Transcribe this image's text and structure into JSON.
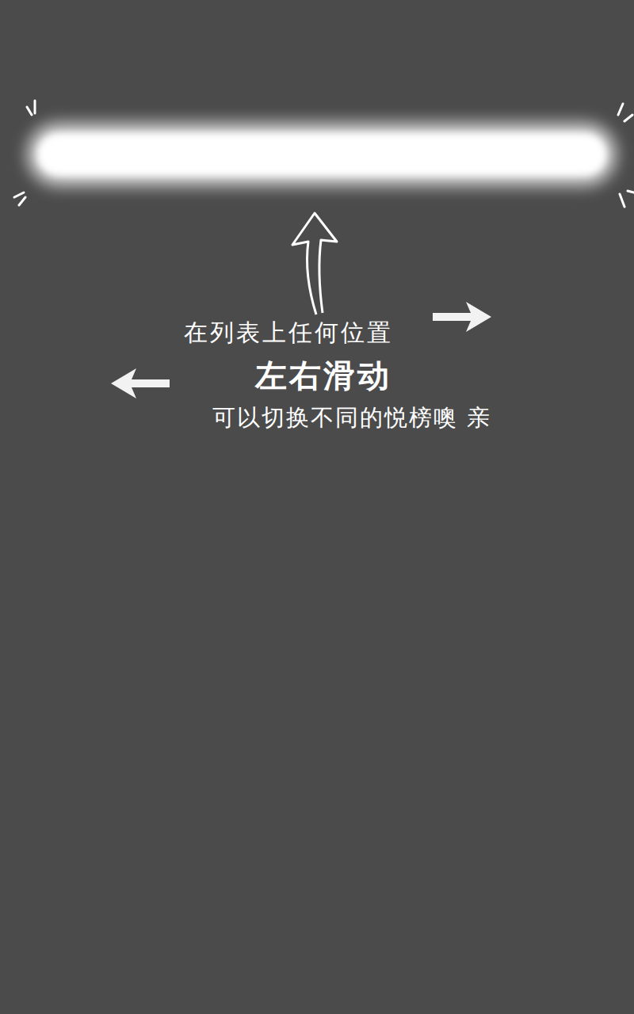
{
  "hint": {
    "line": "在列表上任何位置",
    "emphasis": "左右滑动",
    "detail": "可以切换不同的悦榜噢 亲"
  }
}
